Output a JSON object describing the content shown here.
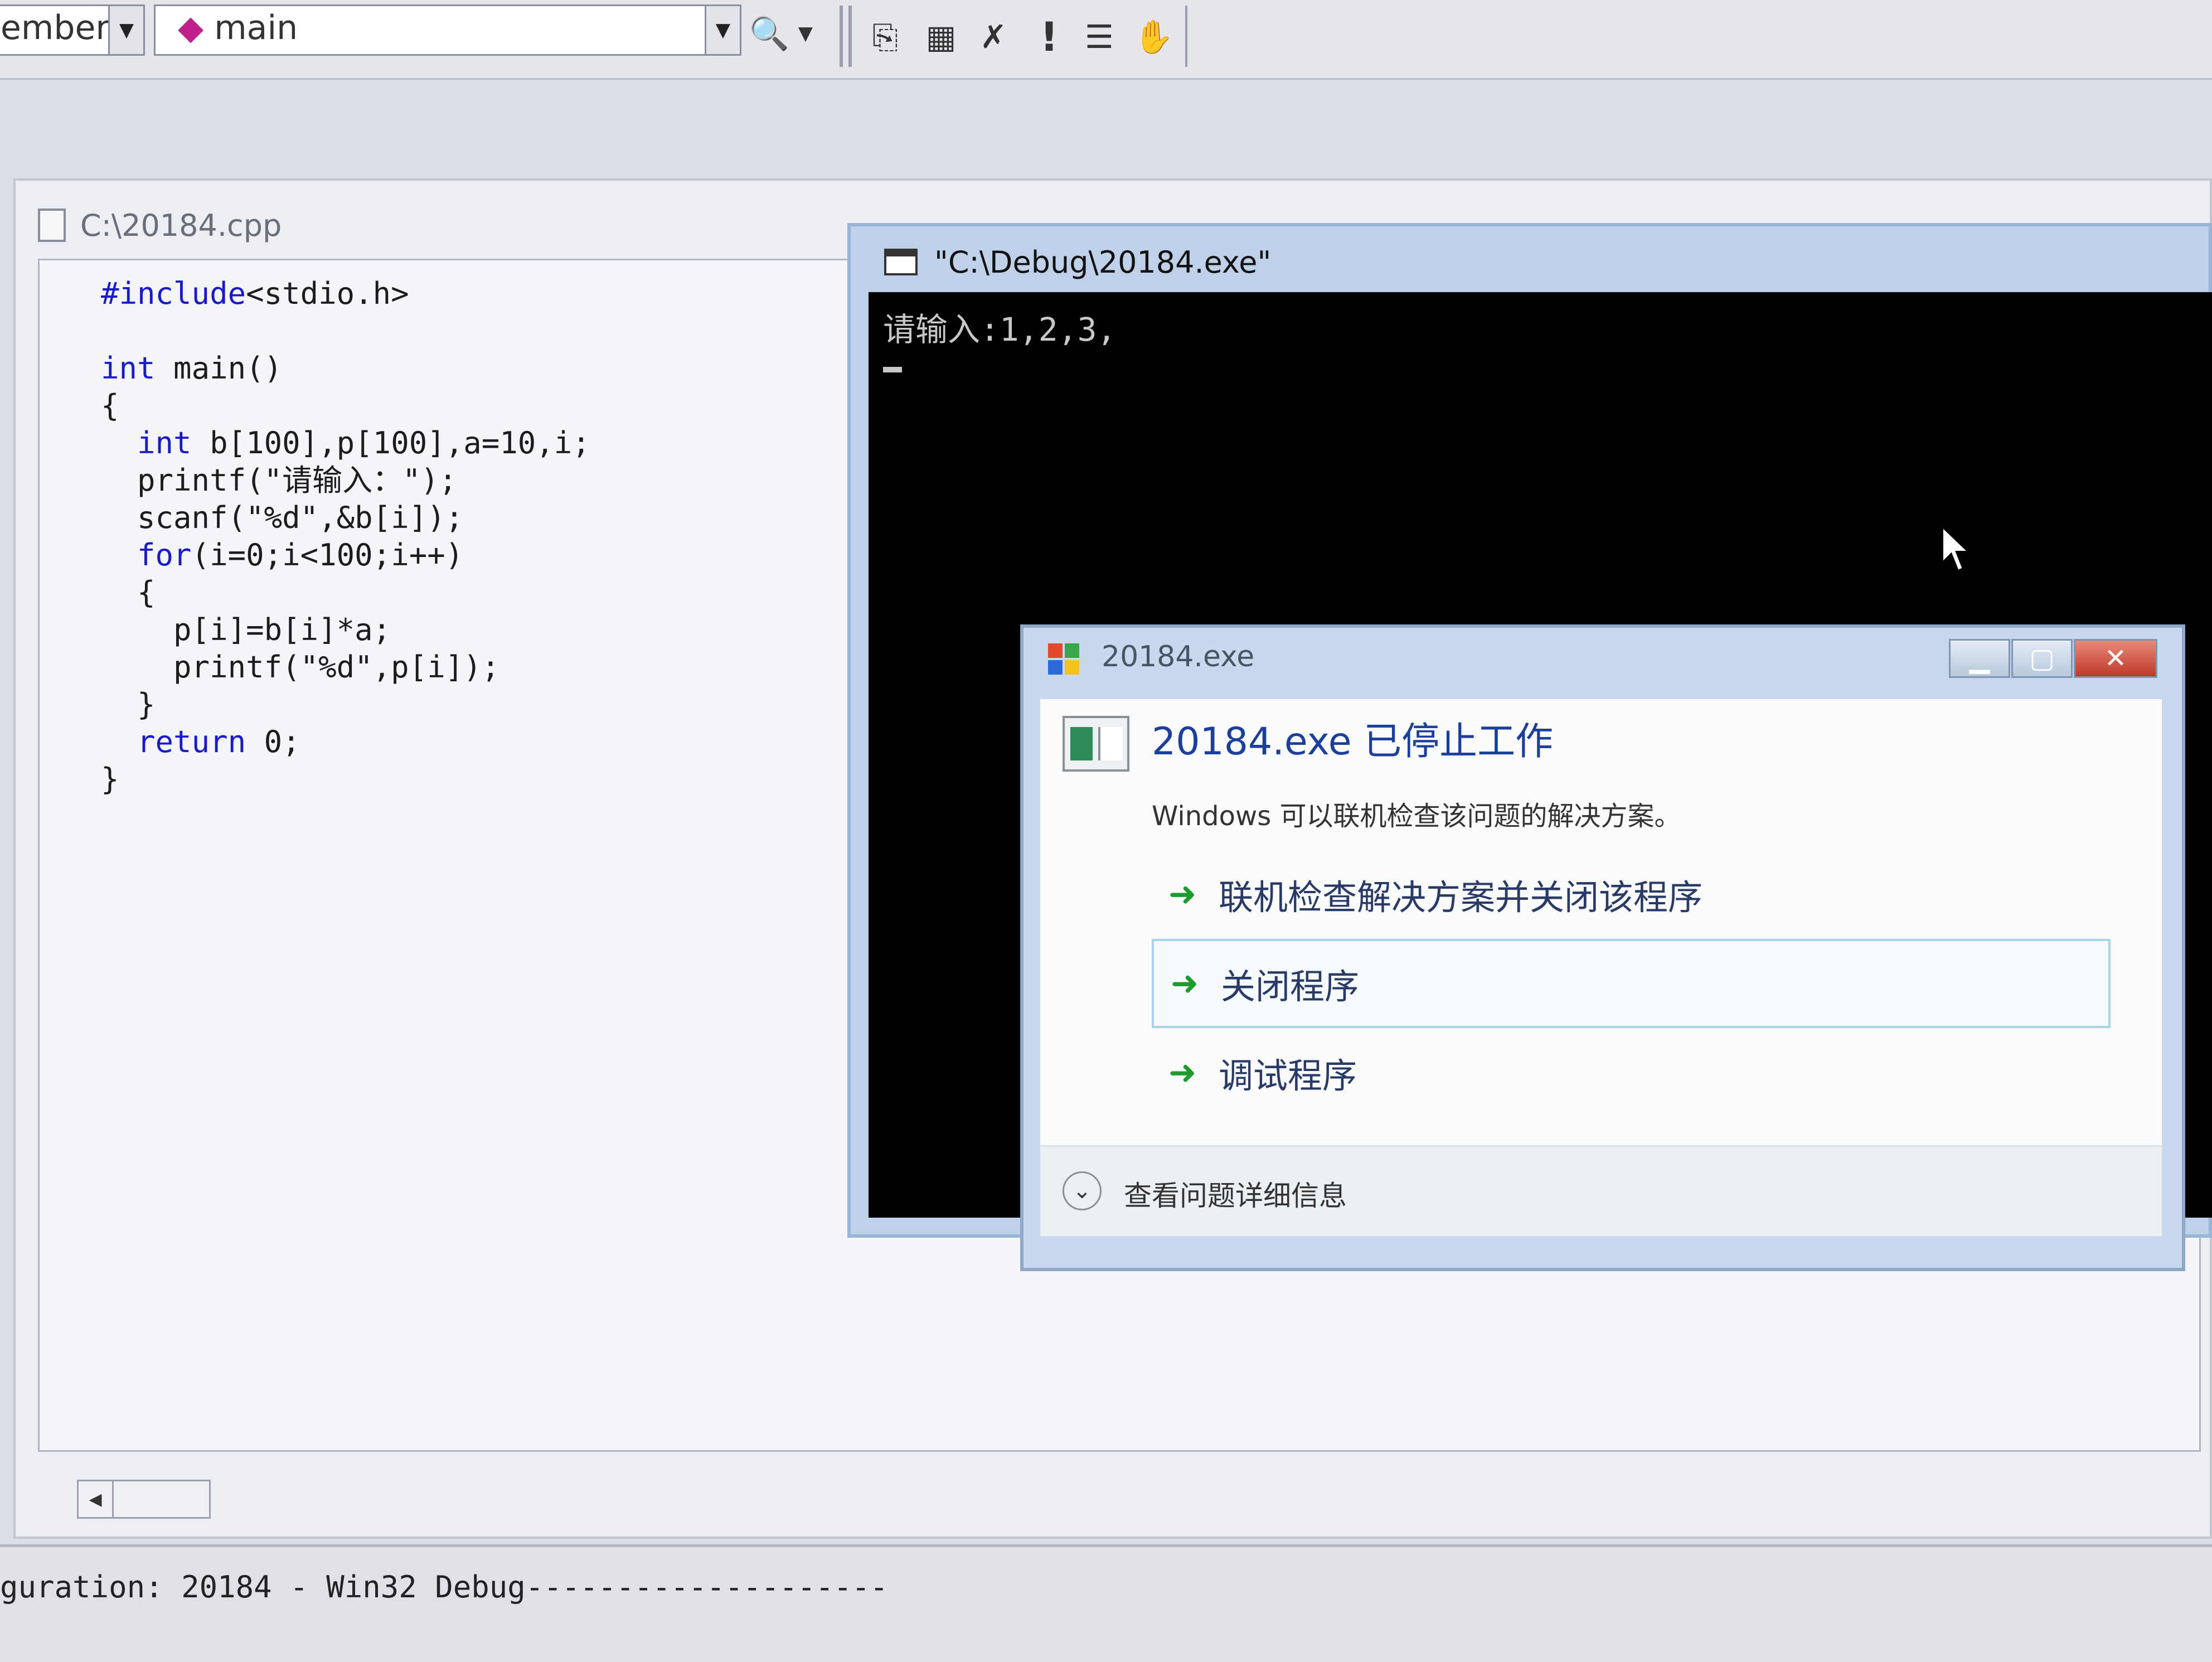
{
  "toolbar": {
    "members_combo": "embers",
    "function_combo": "main",
    "icons": [
      "find-icon",
      "dropdown-icon",
      "compile-icon",
      "build-icon",
      "stop-build-icon",
      "execute-icon",
      "step-into-icon",
      "breakpoint-hand-icon"
    ],
    "execute_glyph": "!"
  },
  "editor": {
    "title": "C:\\20184.cpp",
    "code_lines": [
      "#include<stdio.h>",
      "",
      "int main()",
      "{",
      "  int b[100],p[100],a=10,i;",
      "  printf(\"请输入：\");",
      "  scanf(\"%d\",&b[i]);",
      "  for(i=0;i<100;i++)",
      "  {",
      "    p[i]=b[i]*a;",
      "    printf(\"%d\",p[i]);",
      "  }",
      "  return 0;",
      "}"
    ],
    "keyword_color": "#1a1acd"
  },
  "console": {
    "title": "\"C:\\Debug\\20184.exe\"",
    "output": "请输入:1,2,3,"
  },
  "dialog": {
    "window_title": "20184.exe",
    "heading": "20184.exe 已停止工作",
    "description": "Windows 可以联机检查该问题的解决方案。",
    "options": [
      "联机检查解决方案并关闭该程序",
      "关闭程序",
      "调试程序"
    ],
    "details_label": "查看问题详细信息",
    "heading_color": "#1d3f9c"
  },
  "output": {
    "text": "guration: 20184 - Win32 Debug--------------------"
  }
}
